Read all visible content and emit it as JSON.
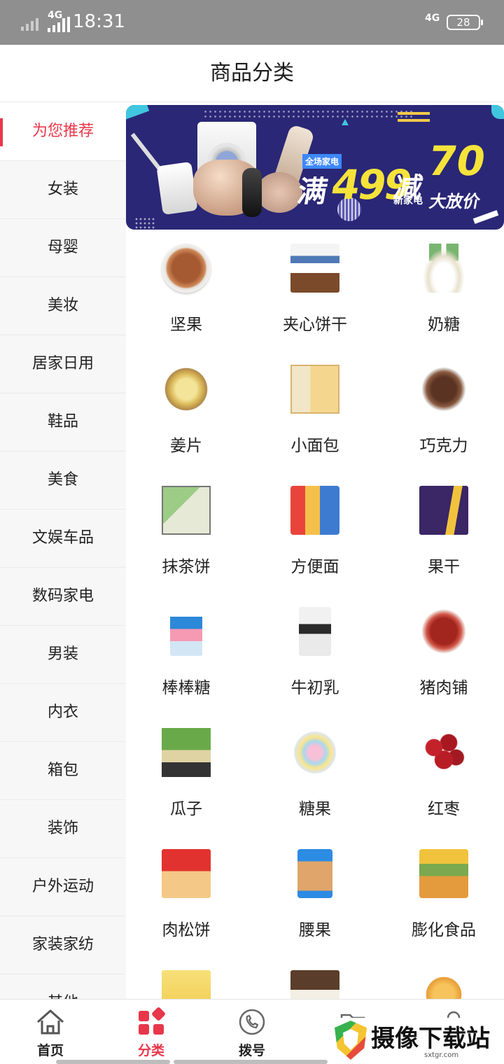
{
  "status_bar": {
    "network_left": "4G",
    "time": "18:31",
    "network_right": "4G",
    "battery": "28"
  },
  "header": {
    "title": "商品分类"
  },
  "sidebar": {
    "items": [
      {
        "label": "为您推荐",
        "active": true
      },
      {
        "label": "女装"
      },
      {
        "label": "母婴"
      },
      {
        "label": "美妆"
      },
      {
        "label": "居家日用"
      },
      {
        "label": "鞋品"
      },
      {
        "label": "美食"
      },
      {
        "label": "文娱车品"
      },
      {
        "label": "数码家电"
      },
      {
        "label": "男装"
      },
      {
        "label": "内衣"
      },
      {
        "label": "箱包"
      },
      {
        "label": "装饰"
      },
      {
        "label": "户外运动"
      },
      {
        "label": "家装家纺"
      },
      {
        "label": "其他"
      }
    ]
  },
  "banner": {
    "tag": "全场家电",
    "man": "满",
    "amount": "499",
    "jian": "减",
    "discount": "70",
    "new_appliance": "新家电",
    "sale": "大放价"
  },
  "products": [
    {
      "label": "坚果",
      "icon": "nuts-image"
    },
    {
      "label": "夹心饼干",
      "icon": "sandwich-biscuit-image"
    },
    {
      "label": "奶糖",
      "icon": "milk-candy-image"
    },
    {
      "label": "姜片",
      "icon": "ginger-slices-image"
    },
    {
      "label": "小面包",
      "icon": "small-bread-image"
    },
    {
      "label": "巧克力",
      "icon": "chocolate-image"
    },
    {
      "label": "抹茶饼",
      "icon": "matcha-cake-image"
    },
    {
      "label": "方便面",
      "icon": "instant-noodles-image"
    },
    {
      "label": "果干",
      "icon": "dried-fruit-image"
    },
    {
      "label": "棒棒糖",
      "icon": "lollipop-image"
    },
    {
      "label": "牛初乳",
      "icon": "colostrum-image"
    },
    {
      "label": "猪肉铺",
      "icon": "pork-jerky-image"
    },
    {
      "label": "瓜子",
      "icon": "sunflower-seeds-image"
    },
    {
      "label": "糖果",
      "icon": "candy-image"
    },
    {
      "label": "红枣",
      "icon": "red-dates-image"
    },
    {
      "label": "肉松饼",
      "icon": "meat-floss-cake-image"
    },
    {
      "label": "腰果",
      "icon": "cashew-image"
    },
    {
      "label": "膨化食品",
      "icon": "puffed-food-image"
    },
    {
      "label": "",
      "icon": "product-image"
    },
    {
      "label": "",
      "icon": "product-image"
    },
    {
      "label": "",
      "icon": "product-image"
    }
  ],
  "bottom_nav": {
    "items": [
      {
        "label": "首页",
        "icon": "home-icon"
      },
      {
        "label": "分类",
        "icon": "category-icon",
        "active": true
      },
      {
        "label": "拨号",
        "icon": "phone-icon"
      },
      {
        "label": "",
        "icon": "folder-icon"
      },
      {
        "label": "",
        "icon": "user-icon"
      }
    ]
  },
  "watermark": {
    "text": "摄像下载站",
    "sub": "sxtgr.com"
  },
  "colors": {
    "accent": "#e8374a",
    "banner_bg": "#2a2776",
    "sidebar_bg": "#f7f7f7",
    "status_bar_bg": "#8f8f8f"
  }
}
